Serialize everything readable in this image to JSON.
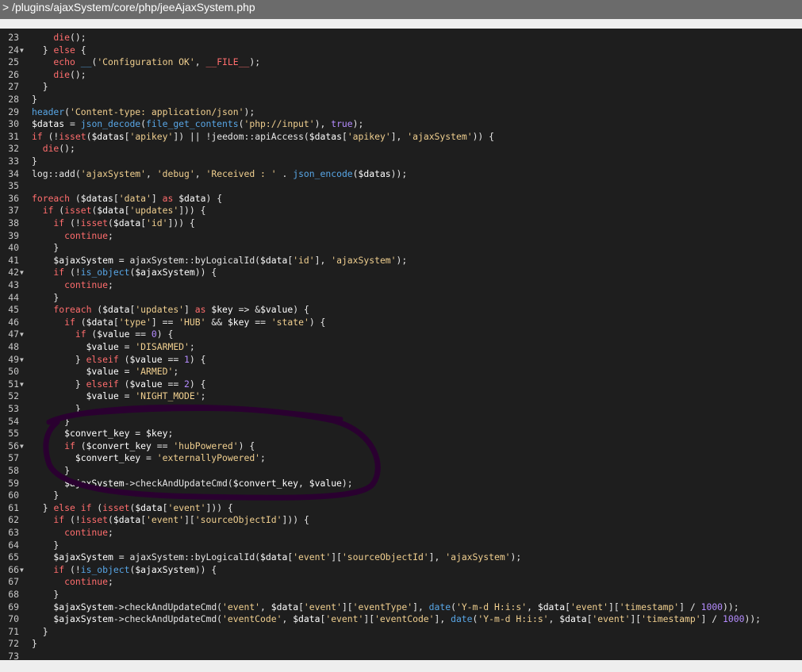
{
  "file_path": "> /plugins/ajaxSystem/core/php/jeeAjaxSystem.php",
  "lines": [
    {
      "n": "23",
      "f": "",
      "t": [
        [
          "kw",
          "    die"
        ],
        [
          "plain",
          "();"
        ]
      ]
    },
    {
      "n": "24",
      "f": "▼",
      "t": [
        [
          "plain",
          "  } "
        ],
        [
          "kw",
          "else"
        ],
        [
          "plain",
          " {"
        ]
      ]
    },
    {
      "n": "25",
      "f": "",
      "t": [
        [
          "kw",
          "    echo "
        ],
        [
          "fn",
          "__"
        ],
        [
          "plain",
          "("
        ],
        [
          "str",
          "'Configuration OK'"
        ],
        [
          "plain",
          ", "
        ],
        [
          "kw",
          "__FILE__"
        ],
        [
          "plain",
          ");"
        ]
      ]
    },
    {
      "n": "26",
      "f": "",
      "t": [
        [
          "kw",
          "    die"
        ],
        [
          "plain",
          "();"
        ]
      ]
    },
    {
      "n": "27",
      "f": "",
      "t": [
        [
          "plain",
          "  }"
        ]
      ]
    },
    {
      "n": "28",
      "f": "",
      "t": [
        [
          "plain",
          "}"
        ]
      ]
    },
    {
      "n": "29",
      "f": "",
      "t": [
        [
          "fn",
          "header"
        ],
        [
          "plain",
          "("
        ],
        [
          "str",
          "'Content-type: application/json'"
        ],
        [
          "plain",
          ");"
        ]
      ]
    },
    {
      "n": "30",
      "f": "",
      "t": [
        [
          "var",
          "$datas"
        ],
        [
          "plain",
          " = "
        ],
        [
          "fn",
          "json_decode"
        ],
        [
          "plain",
          "("
        ],
        [
          "fn",
          "file_get_contents"
        ],
        [
          "plain",
          "("
        ],
        [
          "str",
          "'php://input'"
        ],
        [
          "plain",
          "), "
        ],
        [
          "num",
          "true"
        ],
        [
          "plain",
          ");"
        ]
      ]
    },
    {
      "n": "31",
      "f": "",
      "t": [
        [
          "kw",
          "if"
        ],
        [
          "plain",
          " (!"
        ],
        [
          "kw",
          "isset"
        ],
        [
          "plain",
          "("
        ],
        [
          "var",
          "$datas"
        ],
        [
          "plain",
          "["
        ],
        [
          "str",
          "'apikey'"
        ],
        [
          "plain",
          "]) || !jeedom::apiAccess("
        ],
        [
          "var",
          "$datas"
        ],
        [
          "plain",
          "["
        ],
        [
          "str",
          "'apikey'"
        ],
        [
          "plain",
          "], "
        ],
        [
          "str",
          "'ajaxSystem'"
        ],
        [
          "plain",
          ")) {"
        ]
      ]
    },
    {
      "n": "32",
      "f": "",
      "t": [
        [
          "kw",
          "  die"
        ],
        [
          "plain",
          "();"
        ]
      ]
    },
    {
      "n": "33",
      "f": "",
      "t": [
        [
          "plain",
          "}"
        ]
      ]
    },
    {
      "n": "34",
      "f": "",
      "t": [
        [
          "plain",
          "log::add("
        ],
        [
          "str",
          "'ajaxSystem'"
        ],
        [
          "plain",
          ", "
        ],
        [
          "str",
          "'debug'"
        ],
        [
          "plain",
          ", "
        ],
        [
          "str",
          "'Received : '"
        ],
        [
          "plain",
          " . "
        ],
        [
          "fn",
          "json_encode"
        ],
        [
          "plain",
          "("
        ],
        [
          "var",
          "$datas"
        ],
        [
          "plain",
          "));"
        ]
      ]
    },
    {
      "n": "35",
      "f": "",
      "t": []
    },
    {
      "n": "36",
      "f": "",
      "t": [
        [
          "kw",
          "foreach"
        ],
        [
          "plain",
          " ("
        ],
        [
          "var",
          "$datas"
        ],
        [
          "plain",
          "["
        ],
        [
          "str",
          "'data'"
        ],
        [
          "plain",
          "] "
        ],
        [
          "kw",
          "as"
        ],
        [
          "plain",
          " "
        ],
        [
          "var",
          "$data"
        ],
        [
          "plain",
          ") {"
        ]
      ]
    },
    {
      "n": "37",
      "f": "",
      "t": [
        [
          "kw",
          "  if"
        ],
        [
          "plain",
          " ("
        ],
        [
          "kw",
          "isset"
        ],
        [
          "plain",
          "("
        ],
        [
          "var",
          "$data"
        ],
        [
          "plain",
          "["
        ],
        [
          "str",
          "'updates'"
        ],
        [
          "plain",
          "])) {"
        ]
      ]
    },
    {
      "n": "38",
      "f": "",
      "t": [
        [
          "kw",
          "    if"
        ],
        [
          "plain",
          " (!"
        ],
        [
          "kw",
          "isset"
        ],
        [
          "plain",
          "("
        ],
        [
          "var",
          "$data"
        ],
        [
          "plain",
          "["
        ],
        [
          "str",
          "'id'"
        ],
        [
          "plain",
          "])) {"
        ]
      ]
    },
    {
      "n": "39",
      "f": "",
      "t": [
        [
          "kw",
          "      continue"
        ],
        [
          "plain",
          ";"
        ]
      ]
    },
    {
      "n": "40",
      "f": "",
      "t": [
        [
          "plain",
          "    }"
        ]
      ]
    },
    {
      "n": "41",
      "f": "",
      "t": [
        [
          "var",
          "    $ajaxSystem"
        ],
        [
          "plain",
          " = ajaxSystem::byLogicalId("
        ],
        [
          "var",
          "$data"
        ],
        [
          "plain",
          "["
        ],
        [
          "str",
          "'id'"
        ],
        [
          "plain",
          "], "
        ],
        [
          "str",
          "'ajaxSystem'"
        ],
        [
          "plain",
          ");"
        ]
      ]
    },
    {
      "n": "42",
      "f": "▼",
      "t": [
        [
          "kw",
          "    if"
        ],
        [
          "plain",
          " (!"
        ],
        [
          "fn",
          "is_object"
        ],
        [
          "plain",
          "("
        ],
        [
          "var",
          "$ajaxSystem"
        ],
        [
          "plain",
          ")) {"
        ]
      ]
    },
    {
      "n": "43",
      "f": "",
      "t": [
        [
          "kw",
          "      continue"
        ],
        [
          "plain",
          ";"
        ]
      ]
    },
    {
      "n": "44",
      "f": "",
      "t": [
        [
          "plain",
          "    }"
        ]
      ]
    },
    {
      "n": "45",
      "f": "",
      "t": [
        [
          "kw",
          "    foreach"
        ],
        [
          "plain",
          " ("
        ],
        [
          "var",
          "$data"
        ],
        [
          "plain",
          "["
        ],
        [
          "str",
          "'updates'"
        ],
        [
          "plain",
          "] "
        ],
        [
          "kw",
          "as"
        ],
        [
          "plain",
          " "
        ],
        [
          "var",
          "$key"
        ],
        [
          "plain",
          " => &"
        ],
        [
          "var",
          "$value"
        ],
        [
          "plain",
          ") {"
        ]
      ]
    },
    {
      "n": "46",
      "f": "",
      "t": [
        [
          "kw",
          "      if"
        ],
        [
          "plain",
          " ("
        ],
        [
          "var",
          "$data"
        ],
        [
          "plain",
          "["
        ],
        [
          "str",
          "'type'"
        ],
        [
          "plain",
          "] == "
        ],
        [
          "str",
          "'HUB'"
        ],
        [
          "plain",
          " && "
        ],
        [
          "var",
          "$key"
        ],
        [
          "plain",
          " == "
        ],
        [
          "str",
          "'state'"
        ],
        [
          "plain",
          ") {"
        ]
      ]
    },
    {
      "n": "47",
      "f": "▼",
      "t": [
        [
          "kw",
          "        if"
        ],
        [
          "plain",
          " ("
        ],
        [
          "var",
          "$value"
        ],
        [
          "plain",
          " == "
        ],
        [
          "num",
          "0"
        ],
        [
          "plain",
          ") {"
        ]
      ]
    },
    {
      "n": "48",
      "f": "",
      "t": [
        [
          "var",
          "          $value"
        ],
        [
          "plain",
          " = "
        ],
        [
          "str",
          "'DISARMED'"
        ],
        [
          "plain",
          ";"
        ]
      ]
    },
    {
      "n": "49",
      "f": "▼",
      "t": [
        [
          "plain",
          "        } "
        ],
        [
          "kw",
          "elseif"
        ],
        [
          "plain",
          " ("
        ],
        [
          "var",
          "$value"
        ],
        [
          "plain",
          " == "
        ],
        [
          "num",
          "1"
        ],
        [
          "plain",
          ") {"
        ]
      ]
    },
    {
      "n": "50",
      "f": "",
      "t": [
        [
          "var",
          "          $value"
        ],
        [
          "plain",
          " = "
        ],
        [
          "str",
          "'ARMED'"
        ],
        [
          "plain",
          ";"
        ]
      ]
    },
    {
      "n": "51",
      "f": "▼",
      "t": [
        [
          "plain",
          "        } "
        ],
        [
          "kw",
          "elseif"
        ],
        [
          "plain",
          " ("
        ],
        [
          "var",
          "$value"
        ],
        [
          "plain",
          " == "
        ],
        [
          "num",
          "2"
        ],
        [
          "plain",
          ") {"
        ]
      ]
    },
    {
      "n": "52",
      "f": "",
      "t": [
        [
          "var",
          "          $value"
        ],
        [
          "plain",
          " = "
        ],
        [
          "str",
          "'NIGHT_MODE'"
        ],
        [
          "plain",
          ";"
        ]
      ]
    },
    {
      "n": "53",
      "f": "",
      "t": [
        [
          "plain",
          "        }"
        ]
      ]
    },
    {
      "n": "54",
      "f": "",
      "t": [
        [
          "plain",
          "      }"
        ]
      ]
    },
    {
      "n": "55",
      "f": "",
      "t": [
        [
          "var",
          "      $convert_key"
        ],
        [
          "plain",
          " = "
        ],
        [
          "var",
          "$key"
        ],
        [
          "plain",
          ";"
        ]
      ]
    },
    {
      "n": "56",
      "f": "▼",
      "t": [
        [
          "kw",
          "      if"
        ],
        [
          "plain",
          " ("
        ],
        [
          "var",
          "$convert_key"
        ],
        [
          "plain",
          " == "
        ],
        [
          "str",
          "'hubPowered'"
        ],
        [
          "plain",
          ") {"
        ]
      ]
    },
    {
      "n": "57",
      "f": "",
      "t": [
        [
          "var",
          "        $convert_key"
        ],
        [
          "plain",
          " = "
        ],
        [
          "str",
          "'externallyPowered'"
        ],
        [
          "plain",
          ";"
        ]
      ]
    },
    {
      "n": "58",
      "f": "",
      "t": [
        [
          "plain",
          "      }"
        ]
      ]
    },
    {
      "n": "59",
      "f": "",
      "t": [
        [
          "var",
          "      $ajaxSystem"
        ],
        [
          "plain",
          "->checkAndUpdateCmd("
        ],
        [
          "var",
          "$convert_key"
        ],
        [
          "plain",
          ", "
        ],
        [
          "var",
          "$value"
        ],
        [
          "plain",
          ");"
        ]
      ]
    },
    {
      "n": "60",
      "f": "",
      "t": [
        [
          "plain",
          "    }"
        ]
      ]
    },
    {
      "n": "61",
      "f": "",
      "t": [
        [
          "plain",
          "  } "
        ],
        [
          "kw",
          "else if"
        ],
        [
          "plain",
          " ("
        ],
        [
          "kw",
          "isset"
        ],
        [
          "plain",
          "("
        ],
        [
          "var",
          "$data"
        ],
        [
          "plain",
          "["
        ],
        [
          "str",
          "'event'"
        ],
        [
          "plain",
          "])) {"
        ]
      ]
    },
    {
      "n": "62",
      "f": "",
      "t": [
        [
          "kw",
          "    if"
        ],
        [
          "plain",
          " (!"
        ],
        [
          "kw",
          "isset"
        ],
        [
          "plain",
          "("
        ],
        [
          "var",
          "$data"
        ],
        [
          "plain",
          "["
        ],
        [
          "str",
          "'event'"
        ],
        [
          "plain",
          "]["
        ],
        [
          "str",
          "'sourceObjectId'"
        ],
        [
          "plain",
          "])) {"
        ]
      ]
    },
    {
      "n": "63",
      "f": "",
      "t": [
        [
          "kw",
          "      continue"
        ],
        [
          "plain",
          ";"
        ]
      ]
    },
    {
      "n": "64",
      "f": "",
      "t": [
        [
          "plain",
          "    }"
        ]
      ]
    },
    {
      "n": "65",
      "f": "",
      "t": [
        [
          "var",
          "    $ajaxSystem"
        ],
        [
          "plain",
          " = ajaxSystem::byLogicalId("
        ],
        [
          "var",
          "$data"
        ],
        [
          "plain",
          "["
        ],
        [
          "str",
          "'event'"
        ],
        [
          "plain",
          "]["
        ],
        [
          "str",
          "'sourceObjectId'"
        ],
        [
          "plain",
          "], "
        ],
        [
          "str",
          "'ajaxSystem'"
        ],
        [
          "plain",
          ");"
        ]
      ]
    },
    {
      "n": "66",
      "f": "▼",
      "t": [
        [
          "kw",
          "    if"
        ],
        [
          "plain",
          " (!"
        ],
        [
          "fn",
          "is_object"
        ],
        [
          "plain",
          "("
        ],
        [
          "var",
          "$ajaxSystem"
        ],
        [
          "plain",
          ")) {"
        ]
      ]
    },
    {
      "n": "67",
      "f": "",
      "t": [
        [
          "kw",
          "      continue"
        ],
        [
          "plain",
          ";"
        ]
      ]
    },
    {
      "n": "68",
      "f": "",
      "t": [
        [
          "plain",
          "    }"
        ]
      ]
    },
    {
      "n": "69",
      "f": "",
      "t": [
        [
          "var",
          "    $ajaxSystem"
        ],
        [
          "plain",
          "->checkAndUpdateCmd("
        ],
        [
          "str",
          "'event'"
        ],
        [
          "plain",
          ", "
        ],
        [
          "var",
          "$data"
        ],
        [
          "plain",
          "["
        ],
        [
          "str",
          "'event'"
        ],
        [
          "plain",
          "]["
        ],
        [
          "str",
          "'eventType'"
        ],
        [
          "plain",
          "], "
        ],
        [
          "fn",
          "date"
        ],
        [
          "plain",
          "("
        ],
        [
          "str",
          "'Y-m-d H:i:s'"
        ],
        [
          "plain",
          ", "
        ],
        [
          "var",
          "$data"
        ],
        [
          "plain",
          "["
        ],
        [
          "str",
          "'event'"
        ],
        [
          "plain",
          "]["
        ],
        [
          "str",
          "'timestamp'"
        ],
        [
          "plain",
          "] / "
        ],
        [
          "num",
          "1000"
        ],
        [
          "plain",
          "));"
        ]
      ]
    },
    {
      "n": "70",
      "f": "",
      "t": [
        [
          "var",
          "    $ajaxSystem"
        ],
        [
          "plain",
          "->checkAndUpdateCmd("
        ],
        [
          "str",
          "'eventCode'"
        ],
        [
          "plain",
          ", "
        ],
        [
          "var",
          "$data"
        ],
        [
          "plain",
          "["
        ],
        [
          "str",
          "'event'"
        ],
        [
          "plain",
          "]["
        ],
        [
          "str",
          "'eventCode'"
        ],
        [
          "plain",
          "], "
        ],
        [
          "fn",
          "date"
        ],
        [
          "plain",
          "("
        ],
        [
          "str",
          "'Y-m-d H:i:s'"
        ],
        [
          "plain",
          ", "
        ],
        [
          "var",
          "$data"
        ],
        [
          "plain",
          "["
        ],
        [
          "str",
          "'event'"
        ],
        [
          "plain",
          "]["
        ],
        [
          "str",
          "'timestamp'"
        ],
        [
          "plain",
          "] / "
        ],
        [
          "num",
          "1000"
        ],
        [
          "plain",
          "));"
        ]
      ]
    },
    {
      "n": "71",
      "f": "",
      "t": [
        [
          "plain",
          "  }"
        ]
      ]
    },
    {
      "n": "72",
      "f": "",
      "t": [
        [
          "plain",
          "}"
        ]
      ]
    },
    {
      "n": "73",
      "f": "",
      "t": []
    }
  ],
  "colors": {
    "editor_bg": "#1e1e1e",
    "titlebar_bg": "#6b6b6b",
    "annotation": "#2a0030"
  }
}
